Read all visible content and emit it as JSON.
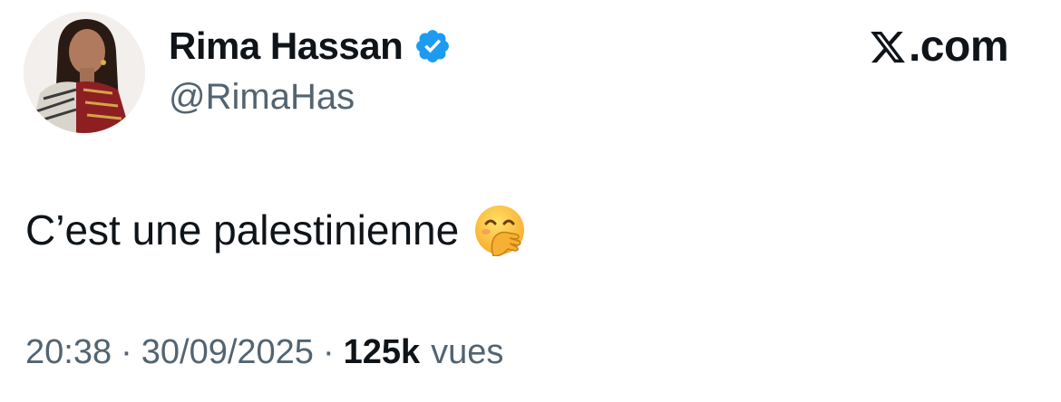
{
  "author": {
    "name": "Rima Hassan",
    "handle": "@RimaHas",
    "verified": true
  },
  "brand": {
    "icon": "x-logo-icon",
    "text": ".com"
  },
  "tweet": {
    "text": "C’est une palestinienne",
    "emoji": "hand-over-mouth-emoji-icon"
  },
  "meta": {
    "time": "20:38",
    "separator": "·",
    "date": "30/09/2025",
    "views_count": "125k",
    "views_label": "vues"
  },
  "colors": {
    "text_primary": "#0f1419",
    "text_secondary": "#536471",
    "verified_blue": "#1d9bf0"
  }
}
